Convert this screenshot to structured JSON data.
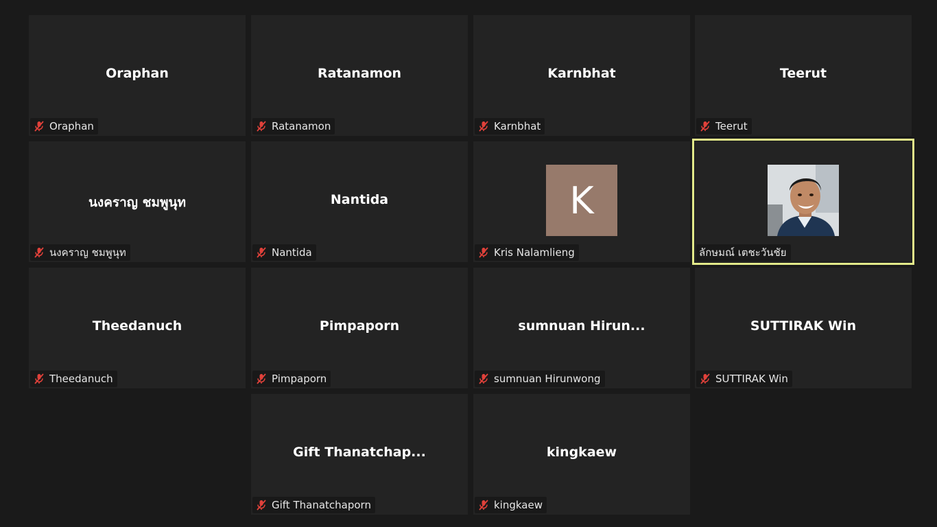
{
  "participants": [
    {
      "display": "Oraphan",
      "label": "Oraphan"
    },
    {
      "display": "Ratanamon",
      "label": "Ratanamon"
    },
    {
      "display": "Karnbhat",
      "label": "Karnbhat"
    },
    {
      "display": "Teerut",
      "label": "Teerut"
    },
    {
      "display": "นงคราญ ชมพูนุท",
      "label": "นงคราญ ชมพูนุท"
    },
    {
      "display": "Nantida",
      "label": "Nantida"
    },
    {
      "avatar_letter": "K",
      "label": "Kris Nalamlieng"
    },
    {
      "label": "ลักษมณ์ เตชะวันชัย"
    },
    {
      "display": "Theedanuch",
      "label": "Theedanuch"
    },
    {
      "display": "Pimpaporn",
      "label": "Pimpaporn"
    },
    {
      "display": "sumnuan  Hirun...",
      "label": "sumnuan Hirunwong"
    },
    {
      "display": "SUTTIRAK Win",
      "label": "SUTTIRAK Win"
    },
    {
      "display": "Gift  Thanatchap...",
      "label": "Gift Thanatchaporn"
    },
    {
      "display": "kingkaew",
      "label": "kingkaew"
    }
  ],
  "icons": {
    "muted_mic": "mic-muted-icon"
  },
  "colors": {
    "background": "#1a1a1a",
    "tile": "#232323",
    "active_speaker_border": "#e3ea8a",
    "muted_icon": "#e0413a",
    "avatar_k": "#977a6b"
  }
}
